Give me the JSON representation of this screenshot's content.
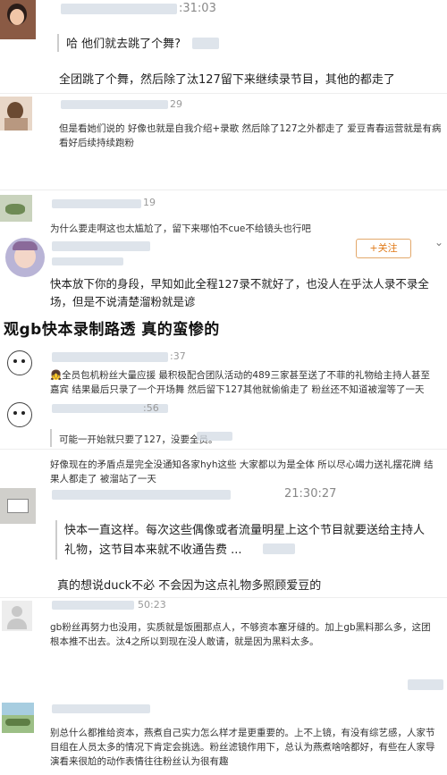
{
  "posts": [
    {
      "meta": ":31:03",
      "quote": "哈 他们就去跳了个舞?",
      "body": "全团跳了个舞，然后除了汰127留下来继续录节目，其他的都走了"
    },
    {
      "meta": "29",
      "body": "但是看她们说的 好像也就是自我介绍+录歌 然后除了127之外都走了 爱豆青春运营就是有病 看好后续持续跑粉"
    },
    {
      "meta": "19",
      "body": "为什么要走啊这也太尴尬了，留下来哪怕不cue不给镜头也行吧"
    },
    {
      "follow": "+关注",
      "body": "快本放下你的身段，早知如此全程127录不就好了，也没人在乎汰人录不录全场，但是不说清楚溜粉就是谚"
    },
    {
      "headline": "观gb快本录制路透 真的蛮惨的"
    },
    {
      "meta": ":37",
      "body": "👧全员包机粉丝大量应援 最积极配合团队活动的489三家甚至送了不菲的礼物给主持人甚至嘉宾 结果最后只录了一个开场舞 然后留下127其他就偷偷走了 粉丝还不知道被溜等了一天"
    },
    {
      "meta": ":56",
      "quote": "可能一开始就只要了127，没要全员。"
    },
    {
      "body": "好像现在的矛盾点是完全没通知各家hyh这些 大家都以为是全体 所以尽心竭力送礼摆花牌 结果人都走了 被溜站了一天"
    },
    {
      "meta": "21:30:27",
      "quote": "快本一直这样。每次这些偶像或者流量明星上这个节目就要送给主持人礼物，这节目本来就不收通告费 ...",
      "body": "真的想说duck不必 不会因为这点礼物多照顾爱豆的"
    },
    {
      "meta": "50:23",
      "body": "gb粉丝再努力也没用，实质就是饭圈那点人，不够资本塞牙缝的。加上gb黑料那么多，这团根本推不出去。汰4之所以到现在没人敢请，就是因为黑料太多。"
    },
    {
      "body": "别总什么都推给资本，燕煮自己实力怎么样才是更重要的。上不上镜，有没有综艺感，人家节目组在人员太多的情况下肯定会挑选。粉丝滤镜作用下，总认为燕煮啥啥都好，有些在人家导演看来很尬的动作表情往往粉丝认为很有趣"
    }
  ],
  "icons": {
    "chevron": "chevron-down-icon"
  }
}
